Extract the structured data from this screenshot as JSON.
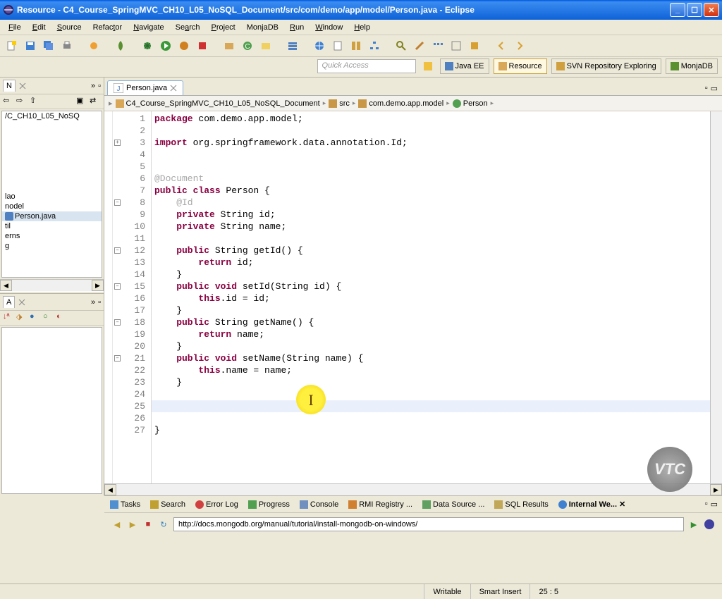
{
  "window": {
    "title": "Resource - C4_Course_SpringMVC_CH10_L05_NoSQL_Document/src/com/demo/app/model/Person.java - Eclipse"
  },
  "menu": [
    "File",
    "Edit",
    "Source",
    "Refactor",
    "Navigate",
    "Search",
    "Project",
    "MonjaDB",
    "Run",
    "Window",
    "Help"
  ],
  "quick_access_placeholder": "Quick Access",
  "perspectives": [
    {
      "label": "Java EE"
    },
    {
      "label": "Resource",
      "active": true
    },
    {
      "label": "SVN Repository Exploring"
    },
    {
      "label": "MonjaDB"
    }
  ],
  "left": {
    "nav_view_label": "N",
    "project_path_fragment": "/C_CH10_L05_NoSQ",
    "tree_items": [
      "lao",
      "nodel",
      "Person.java",
      "til",
      "erns",
      "g"
    ],
    "selected_index": 2,
    "outline_view_label": "A"
  },
  "editor": {
    "tab_label": "Person.java",
    "breadcrumb": [
      "C4_Course_SpringMVC_CH10_L05_NoSQL_Document",
      "src",
      "com.demo.app.model",
      "Person"
    ],
    "lines": [
      {
        "n": 1,
        "t": "package",
        "rest": " com.demo.app.model;"
      },
      {
        "n": 2,
        "t": ""
      },
      {
        "n": 3,
        "t": "import",
        "rest": " org.springframework.data.annotation.Id;",
        "fold": "+"
      },
      {
        "n": 4,
        "t": ""
      },
      {
        "n": 5,
        "t": ""
      },
      {
        "n": 6,
        "ann": "@Document"
      },
      {
        "n": 7,
        "t": "public class",
        "rest": " Person {"
      },
      {
        "n": 8,
        "ann": "    @Id",
        "fold": "-"
      },
      {
        "n": 9,
        "t": "    private",
        "rest": " String id;"
      },
      {
        "n": 10,
        "t": "    private",
        "rest": " String name;"
      },
      {
        "n": 11,
        "t": ""
      },
      {
        "n": 12,
        "t": "    public",
        "rest": " String getId() {",
        "fold": "-"
      },
      {
        "n": 13,
        "t": "        return",
        "rest": " id;"
      },
      {
        "n": 14,
        "rest": "    }"
      },
      {
        "n": 15,
        "t": "    public void",
        "rest": " setId(String id) {",
        "fold": "-"
      },
      {
        "n": 16,
        "t": "        this",
        "rest": ".id = id;"
      },
      {
        "n": 17,
        "rest": "    }"
      },
      {
        "n": 18,
        "t": "    public",
        "rest": " String getName() {",
        "fold": "-"
      },
      {
        "n": 19,
        "t": "        return",
        "rest": " name;"
      },
      {
        "n": 20,
        "rest": "    }"
      },
      {
        "n": 21,
        "t": "    public void",
        "rest": " setName(String name) {",
        "fold": "-"
      },
      {
        "n": 22,
        "t": "        this",
        "rest": ".name = name;"
      },
      {
        "n": 23,
        "rest": "    }"
      },
      {
        "n": 24,
        "t": ""
      },
      {
        "n": 25,
        "t": "",
        "cur": true
      },
      {
        "n": 26,
        "t": ""
      },
      {
        "n": 27,
        "rest": "}"
      }
    ]
  },
  "bottom": {
    "tabs": [
      "Tasks",
      "Search",
      "Error Log",
      "Progress",
      "Console",
      "RMI Registry ...",
      "Data Source ...",
      "SQL Results",
      "Internal We..."
    ],
    "active_tab_index": 8,
    "url": "http://docs.mongodb.org/manual/tutorial/install-mongodb-on-windows/"
  },
  "status": {
    "writable": "Writable",
    "insert_mode": "Smart Insert",
    "cursor": "25 : 5"
  },
  "watermark": "VTC"
}
